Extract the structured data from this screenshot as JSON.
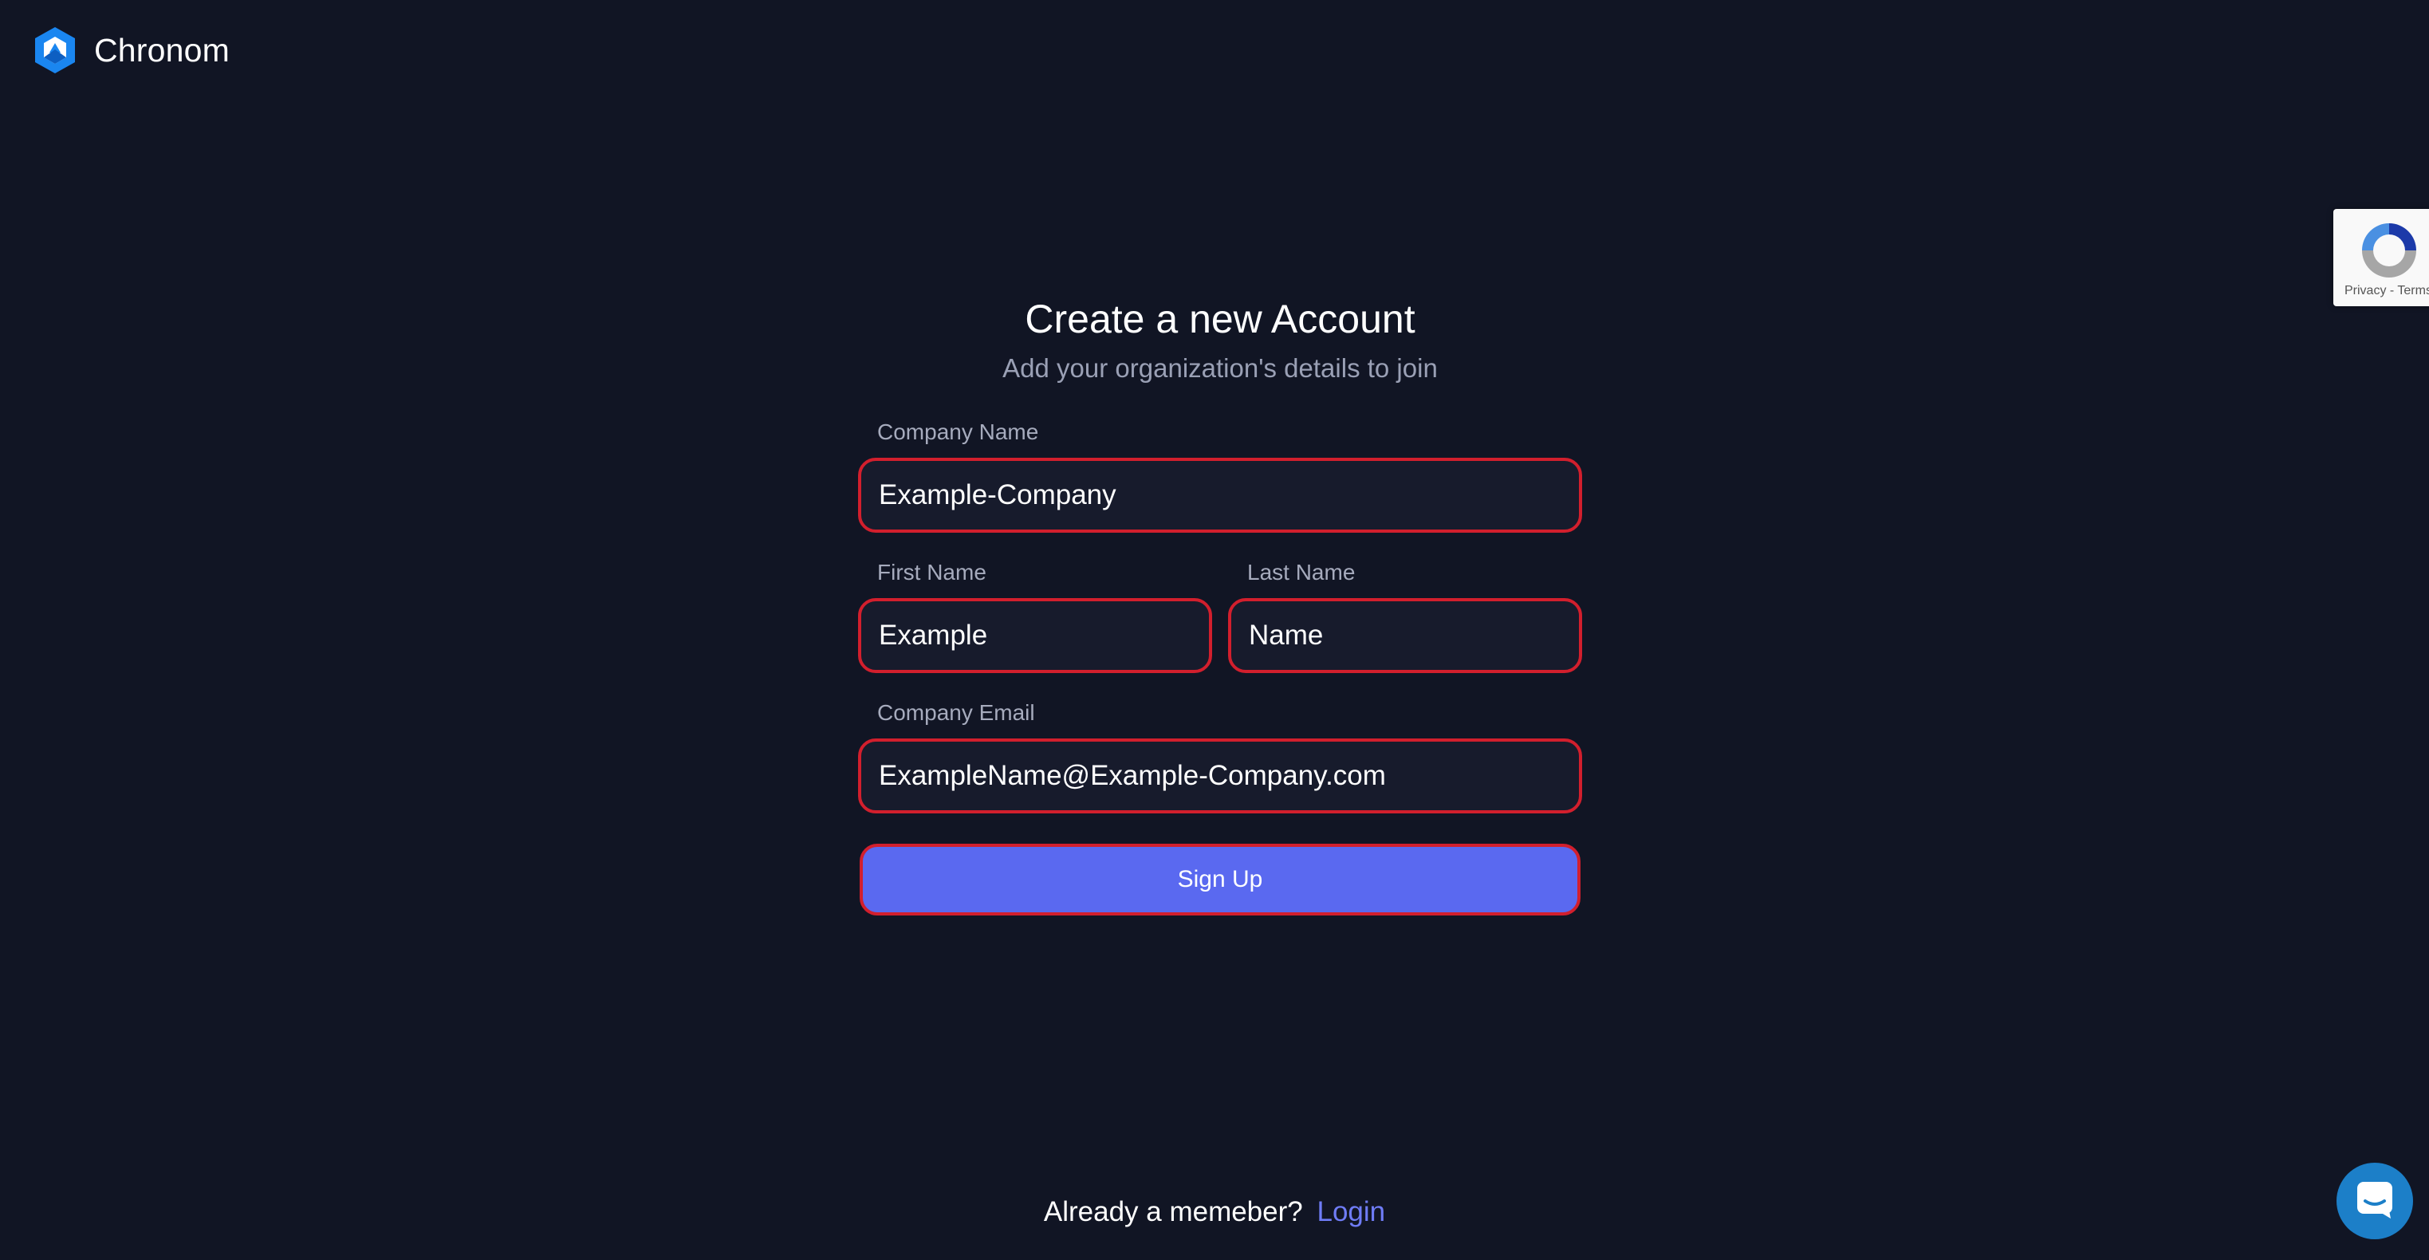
{
  "brand": {
    "name": "Chronom",
    "logo_icon": "hexagon-logo-icon",
    "accent": "#2d8cf0"
  },
  "form": {
    "title": "Create a new Account",
    "subtitle": "Add your organization's details to join",
    "company_name": {
      "label": "Company Name",
      "value": "Example-Company"
    },
    "first_name": {
      "label": "First Name",
      "value": "Example"
    },
    "last_name": {
      "label": "Last Name",
      "value": "Name"
    },
    "company_email": {
      "label": "Company Email",
      "value": "ExampleName@Example-Company.com"
    },
    "submit_label": "Sign Up"
  },
  "footer": {
    "prompt": "Already a memeber?",
    "login_label": "Login"
  },
  "recaptcha": {
    "text": "Privacy - Terms",
    "icon": "recaptcha-icon"
  },
  "chat": {
    "icon": "chat-bubble-icon"
  },
  "colors": {
    "background": "#111524",
    "input_bg": "#171b2c",
    "highlight_border": "#d21f2d",
    "button": "#5a69f0",
    "link": "#6f7cf6"
  }
}
